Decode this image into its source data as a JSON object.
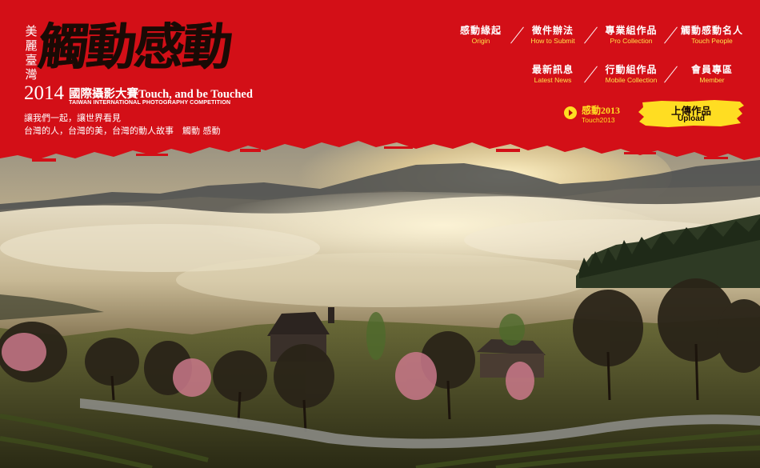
{
  "logo": {
    "vertical_text": [
      "美",
      "麗",
      "臺",
      "灣"
    ],
    "calligraphy": "觸動感動",
    "year": "2014",
    "title": "國際攝影大賽Touch, and be Touched",
    "subtitle": "TAIWAN INTERNATIONAL PHOTOGRAPHY COMPETITION"
  },
  "tagline": {
    "line1": "讓我們一起，讓世界看見",
    "line2": "台灣的人，台灣的美，台灣的動人故事　觸動 感動"
  },
  "nav": {
    "items": [
      {
        "zh": "感動緣起",
        "en": "Origin"
      },
      {
        "zh": "徵件辦法",
        "en": "How to Submit"
      },
      {
        "zh": "專業組作品",
        "en": "Pro Collection"
      },
      {
        "zh": "觸動感動名人",
        "en": "Touch People"
      },
      {
        "zh": "最新訊息",
        "en": "Latest News"
      },
      {
        "zh": "行動組作品",
        "en": "Mobile Collection"
      },
      {
        "zh": "會員專區",
        "en": "Member"
      }
    ]
  },
  "touch2013": {
    "zh": "感動2013",
    "en": "Touch2013"
  },
  "upload": {
    "zh": "上傳作品",
    "en": "Upload"
  },
  "colors": {
    "banner_red": "#d30f17",
    "accent_yellow": "#ffdd22",
    "nav_english": "#ffe14a"
  }
}
